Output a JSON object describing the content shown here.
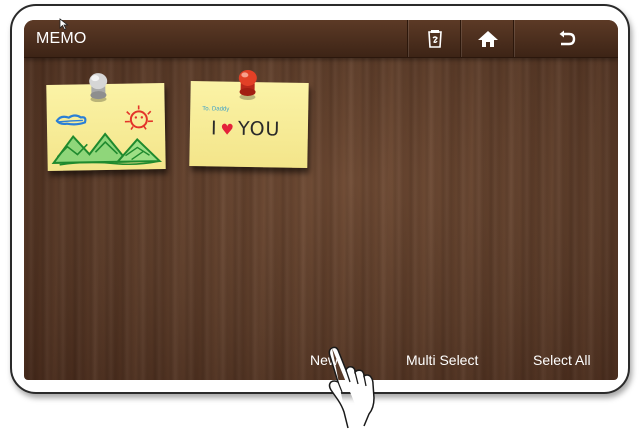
{
  "app": {
    "title": "MEMO"
  },
  "toolbar": {
    "buttons": [
      {
        "name": "memo-menu",
        "icon": "memo-pad-icon"
      },
      {
        "name": "home",
        "icon": "home-icon"
      },
      {
        "name": "back",
        "icon": "back-arrow-icon"
      }
    ]
  },
  "memos": [
    {
      "type": "drawing",
      "pin_color": "#bdbdbd",
      "note_color": "#f7ec98"
    },
    {
      "type": "text",
      "pin_color": "#e03a23",
      "note_color": "#f7ec98",
      "small_text": "To. Daddy",
      "message_before": "I",
      "message_after": "YOU"
    }
  ],
  "bottom_bar": {
    "new_label": "New",
    "multi_select_label": "Multi Select",
    "select_all_label": "Select All"
  },
  "colors": {
    "wood": "#5a3a27",
    "titlebar": "#4a2d1c",
    "note": "#f7ec98",
    "heart": "#e4223a"
  }
}
